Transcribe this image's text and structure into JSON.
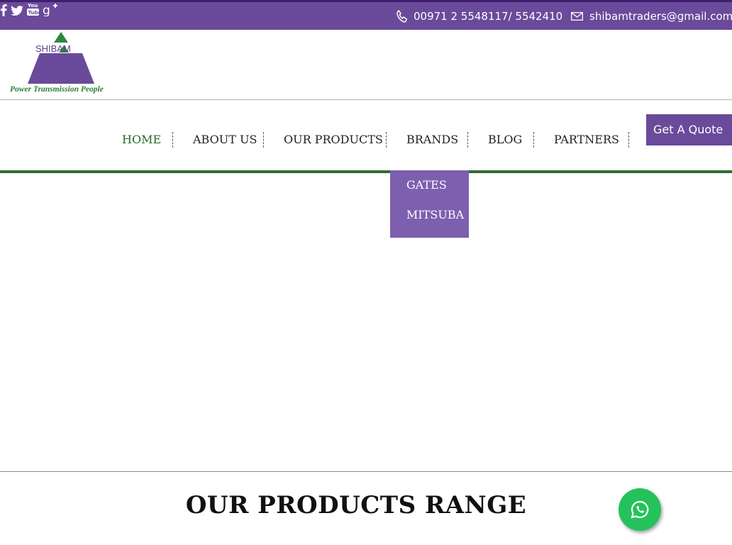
{
  "topbar": {
    "social_icons": [
      "facebook-icon",
      "twitter-icon",
      "youtube-icon",
      "google-plus-icon"
    ],
    "phone": "00971 2 5548117/ 5542410",
    "email": "shibamtraders@gmail.com"
  },
  "logo": {
    "name": "SHIBAM",
    "tagline": "Power Transmission People"
  },
  "nav": {
    "items": [
      {
        "label": "HOME",
        "active": true
      },
      {
        "label": "ABOUT US",
        "active": false
      },
      {
        "label": "OUR PRODUCTS",
        "active": false
      },
      {
        "label": "BRANDS",
        "active": false
      },
      {
        "label": "BLOG",
        "active": false
      },
      {
        "label": "PARTNERS",
        "active": false
      }
    ],
    "quote_button": "Get A Quote",
    "brands_dropdown": [
      "GATES",
      "MITSUBA"
    ]
  },
  "main": {
    "section_title": "OUR PRODUCTS RANGE"
  },
  "colors": {
    "brand_purple": "#6a4a9a",
    "dropdown_purple": "#7d5fb0",
    "accent_green": "#2f6b2f",
    "whatsapp_green": "#25c25c"
  },
  "floating": {
    "whatsapp_icon": "whatsapp-icon"
  }
}
